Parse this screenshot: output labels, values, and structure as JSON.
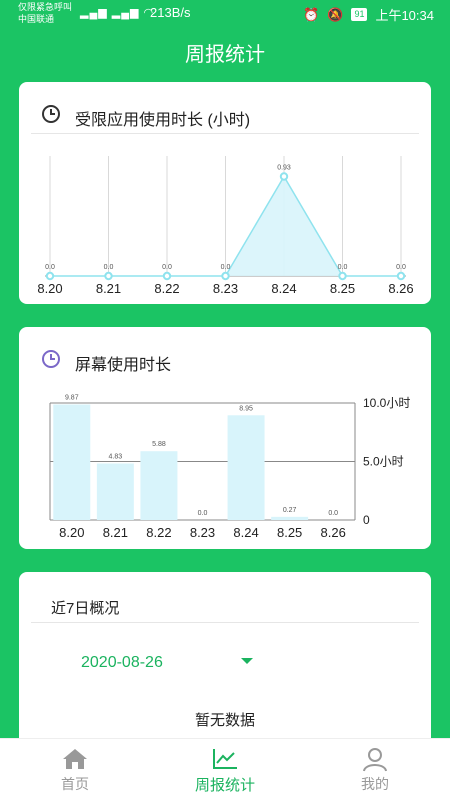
{
  "status_bar": {
    "carrier_line1": "仅限紧急呼叫",
    "carrier_line2": "中国联通",
    "network_speed": "213B/s",
    "battery": "91",
    "time": "上午10:34"
  },
  "header": {
    "title": "周报统计"
  },
  "restricted_card": {
    "title": "受限应用使用时长 (小时)"
  },
  "screen_card": {
    "title": "屏幕使用时长"
  },
  "overview_card": {
    "title": "近7日概况",
    "selected_date": "2020-08-26",
    "empty_text": "暂无数据"
  },
  "tabs": [
    {
      "label": "首页",
      "icon": "home-icon"
    },
    {
      "label": "周报统计",
      "icon": "chart-line-icon"
    },
    {
      "label": "我的",
      "icon": "user-icon"
    }
  ],
  "colors": {
    "accent": "#1bc464",
    "line": "#8fe3ee",
    "bar": "#d8f4fb"
  },
  "chart_data": [
    {
      "type": "area",
      "categories": [
        "8.20",
        "8.21",
        "8.22",
        "8.23",
        "8.24",
        "8.25",
        "8.26"
      ],
      "values": [
        0.0,
        0.0,
        0.0,
        0.0,
        0.93,
        0.0,
        0.0
      ],
      "value_labels": [
        "0.0",
        "0.0",
        "0.0",
        "0.0",
        "0.93",
        "0.0",
        "0.0"
      ],
      "ylim": [
        0,
        1.0
      ],
      "grid": "vertical"
    },
    {
      "type": "bar",
      "categories": [
        "8.20",
        "8.21",
        "8.22",
        "8.23",
        "8.24",
        "8.25",
        "8.26"
      ],
      "values": [
        9.87,
        4.83,
        5.88,
        0.0,
        8.95,
        0.27,
        0.0
      ],
      "value_labels": [
        "9.87",
        "4.83",
        "5.88",
        "0.0",
        "8.95",
        "0.27",
        "0.0"
      ],
      "ylim": [
        0,
        10
      ],
      "yticks": [
        "0",
        "5.0小时",
        "10.0小时"
      ],
      "ytick_values": [
        0,
        5,
        10
      ],
      "grid": "horizontal"
    }
  ]
}
